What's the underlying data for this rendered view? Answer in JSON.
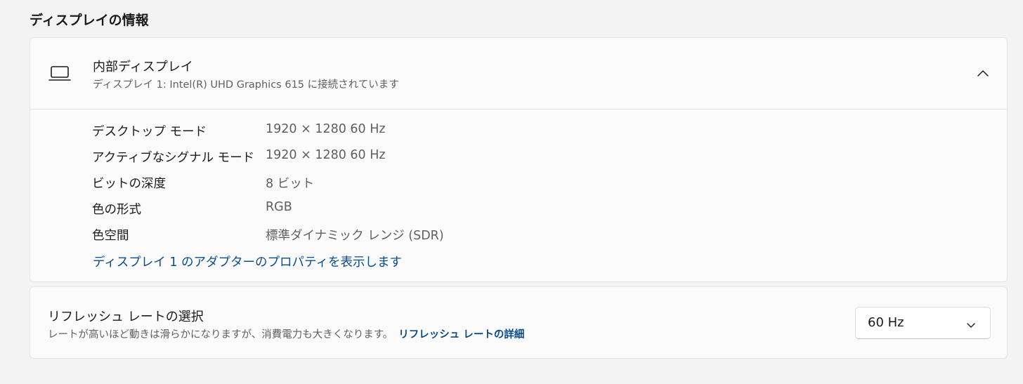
{
  "section": {
    "title": "ディスプレイの情報"
  },
  "display": {
    "icon": "laptop-icon",
    "title": "内部ディスプレイ",
    "subtitle": "ディスプレイ 1: Intel(R) UHD Graphics 615 に接続されています",
    "collapse_icon": "chevron-up-icon",
    "details": [
      {
        "label": "デスクトップ モード",
        "value": "1920 × 1280 60 Hz"
      },
      {
        "label": "アクティブなシグナル モード",
        "value": "1920 × 1280 60 Hz"
      },
      {
        "label": "ビットの深度",
        "value": "8 ビット"
      },
      {
        "label": "色の形式",
        "value": "RGB"
      },
      {
        "label": "色空間",
        "value": "標準ダイナミック レンジ (SDR)"
      }
    ],
    "adapter_link": "ディスプレイ 1 のアダプターのプロパティを表示します"
  },
  "refresh": {
    "title": "リフレッシュ レートの選択",
    "description": "レートが高いほど動きは滑らかになりますが、消費電力も大きくなります。",
    "link": "リフレッシュ レートの詳細",
    "selected": "60 Hz",
    "dropdown_icon": "chevron-down-icon"
  },
  "colors": {
    "background": "#f3f3f3",
    "card": "#fbfbfb",
    "link": "#0a4b8e",
    "secondary_text": "#5f5f5f"
  }
}
